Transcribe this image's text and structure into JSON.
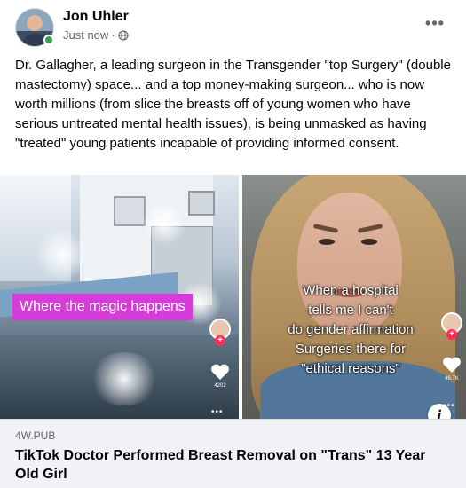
{
  "post": {
    "author": "Jon Uhler",
    "timestamp": "Just now",
    "separator": "·",
    "privacy_icon": "globe-icon",
    "more_label": "•••",
    "text": "Dr. Gallagher, a leading surgeon in the Transgender \"top Surgery\" (double mastectomy) space... and a top money-making surgeon... who is now worth millions (from slice the breasts off of young women who have serious untreated mental health issues), is being unmasked as having \"treated\" young patients incapable of providing informed consent."
  },
  "media": {
    "left_caption": "Where the magic happens",
    "left_like_count": "4202",
    "right_caption_lines": [
      "When a hospital",
      "tells me I can't",
      "do gender affirmation",
      "Surgeries there for",
      "\"ethical reasons\""
    ],
    "right_like_count": "46.7K",
    "info_label": "i"
  },
  "link": {
    "domain": "4W.PUB",
    "title": "TikTok Doctor Performed Breast Removal on \"Trans\" 13 Year Old Girl"
  },
  "colors": {
    "caption_bg": "#d63dd8",
    "online": "#31a24c",
    "secondary_text": "#65676b",
    "link_bg": "#f0f2f5"
  }
}
